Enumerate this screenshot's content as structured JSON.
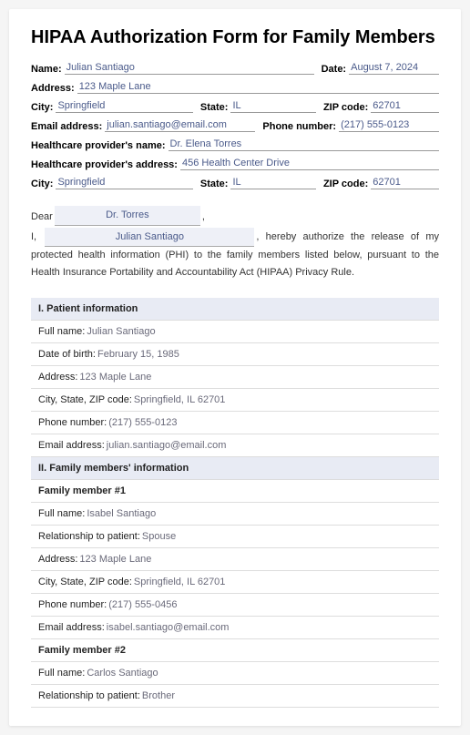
{
  "title": "HIPAA Authorization Form for Family Members",
  "header": {
    "name_label": "Name:",
    "name": "Julian Santiago",
    "date_label": "Date:",
    "date": "August 7, 2024",
    "address_label": "Address:",
    "address": "123 Maple Lane",
    "city_label": "City:",
    "city": "Springfield",
    "state_label": "State:",
    "state": "IL",
    "zip_label": "ZIP code:",
    "zip": "62701",
    "email_label": "Email address:",
    "email": "julian.santiago@email.com",
    "phone_label": "Phone number:",
    "phone": "(217) 555-0123",
    "provider_name_label": "Healthcare provider's name:",
    "provider_name": "Dr. Elena Torres",
    "provider_address_label": "Healthcare provider's address:",
    "provider_address": "456 Health Center Drive",
    "provider_city_label": "City:",
    "provider_city": "Springfield",
    "provider_state_label": "State:",
    "provider_state": "IL",
    "provider_zip_label": "ZIP code:",
    "provider_zip": "62701"
  },
  "letter": {
    "dear": "Dear",
    "recipient": "Dr. Torres",
    "comma": ",",
    "i": "I,",
    "name": "Julian Santiago",
    "body": ", hereby authorize the release of my protected health information (PHI) to the family members listed below, pursuant to the Health Insurance Portability and Accountability Act (HIPAA) Privacy Rule."
  },
  "sections": {
    "s1": {
      "title": "I. Patient information",
      "fullname_label": "Full name:",
      "fullname": "Julian Santiago",
      "dob_label": "Date of birth:",
      "dob": "February 15, 1985",
      "address_label": "Address:",
      "address": "123 Maple Lane",
      "csz_label": "City, State, ZIP code:",
      "csz": "Springfield, IL 62701",
      "phone_label": "Phone number:",
      "phone": "(217) 555-0123",
      "email_label": "Email address:",
      "email": "julian.santiago@email.com"
    },
    "s2": {
      "title": "II. Family members' information",
      "m1_title": "Family member #1",
      "m1_fullname_label": "Full name:",
      "m1_fullname": "Isabel Santiago",
      "m1_rel_label": "Relationship to patient:",
      "m1_rel": "Spouse",
      "m1_address_label": "Address:",
      "m1_address": "123 Maple Lane",
      "m1_csz_label": "City, State, ZIP code:",
      "m1_csz": "Springfield, IL 62701",
      "m1_phone_label": "Phone number:",
      "m1_phone": "(217) 555-0456",
      "m1_email_label": "Email address:",
      "m1_email": "isabel.santiago@email.com",
      "m2_title": "Family member #2",
      "m2_fullname_label": "Full name:",
      "m2_fullname": "Carlos Santiago",
      "m2_rel_label": "Relationship to patient:",
      "m2_rel": "Brother"
    }
  }
}
